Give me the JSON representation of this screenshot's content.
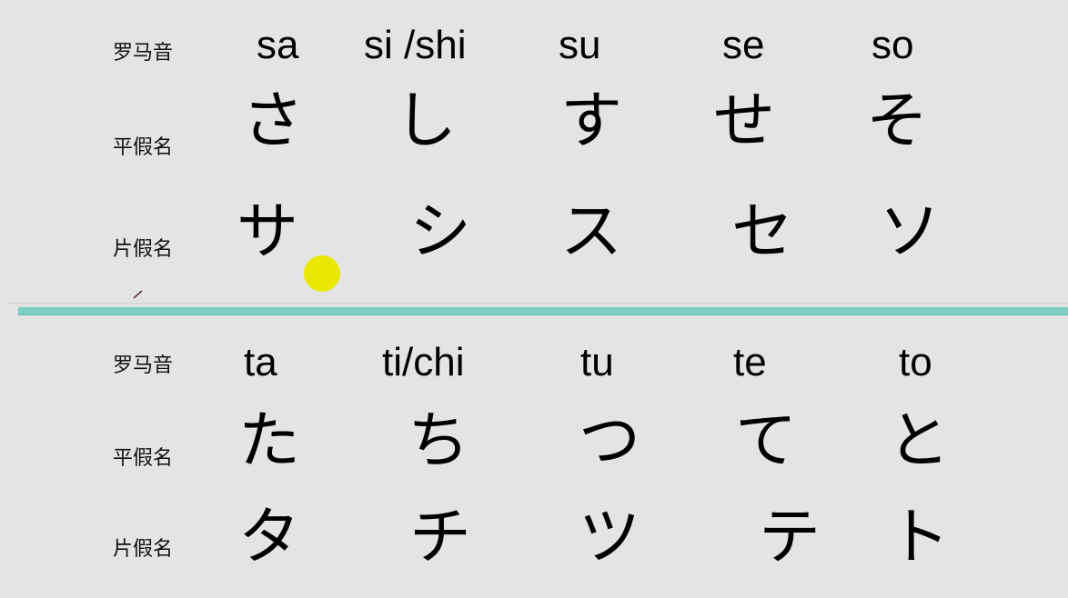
{
  "sections": [
    {
      "row_labels": {
        "romaji": "罗马音",
        "hiragana": "平假名",
        "katakana": "片假名"
      },
      "columns": [
        {
          "romaji": "sa",
          "hiragana": "さ",
          "katakana": "サ"
        },
        {
          "romaji": "si /shi",
          "hiragana": "し",
          "katakana": "シ"
        },
        {
          "romaji": "su",
          "hiragana": "す",
          "katakana": "ス"
        },
        {
          "romaji": "se",
          "hiragana": "せ",
          "katakana": "セ"
        },
        {
          "romaji": "so",
          "hiragana": "そ",
          "katakana": "ソ"
        }
      ]
    },
    {
      "row_labels": {
        "romaji": "罗马音",
        "hiragana": "平假名",
        "katakana": "片假名"
      },
      "columns": [
        {
          "romaji": "ta",
          "hiragana": "た",
          "katakana": "タ"
        },
        {
          "romaji": "ti/chi",
          "hiragana": "ち",
          "katakana": "チ"
        },
        {
          "romaji": "tu",
          "hiragana": "つ",
          "katakana": "ツ"
        },
        {
          "romaji": "te",
          "hiragana": "て",
          "katakana": "テ"
        },
        {
          "romaji": "to",
          "hiragana": "と",
          "katakana": "ト"
        }
      ]
    }
  ],
  "colors": {
    "background": "#e4e4e4",
    "divider": "#7dcfc3",
    "cursor_highlight": "#e8e800"
  },
  "icons": {
    "cursor": "cursor-highlight-icon",
    "pen": "pen-icon"
  }
}
